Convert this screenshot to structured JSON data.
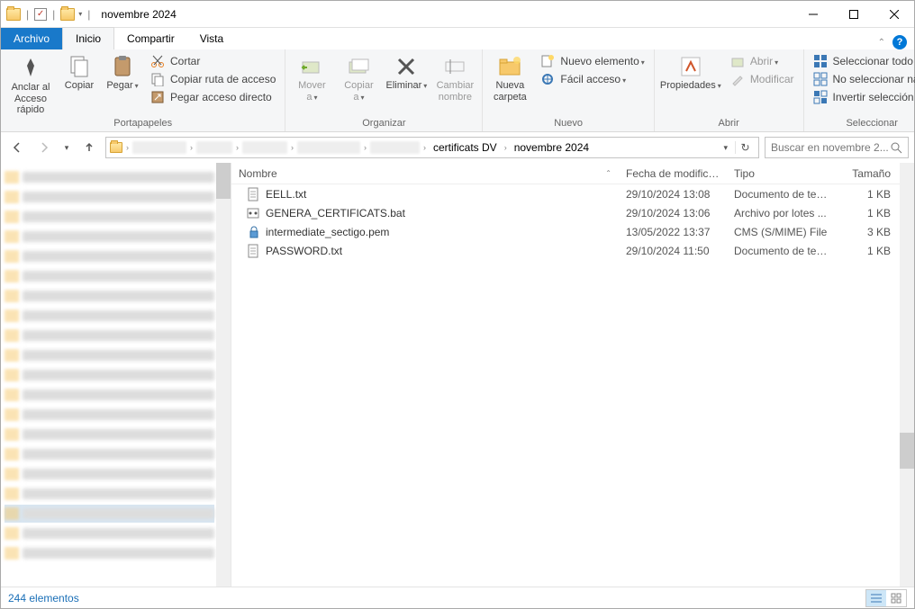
{
  "window": {
    "title": "novembre 2024"
  },
  "tabs": {
    "file": "Archivo",
    "home": "Inicio",
    "share": "Compartir",
    "view": "Vista"
  },
  "ribbon": {
    "clipboard": {
      "label": "Portapapeles",
      "pin": "Anclar al\nAcceso rápido",
      "copy": "Copiar",
      "paste": "Pegar",
      "cut": "Cortar",
      "copy_path": "Copiar ruta de acceso",
      "paste_shortcut": "Pegar acceso directo"
    },
    "organize": {
      "label": "Organizar",
      "move": "Mover\na",
      "copy_to": "Copiar\na",
      "delete": "Eliminar",
      "rename": "Cambiar\nnombre"
    },
    "new": {
      "label": "Nuevo",
      "folder": "Nueva\ncarpeta",
      "item": "Nuevo elemento",
      "easy": "Fácil acceso"
    },
    "open": {
      "label": "Abrir",
      "props": "Propiedades",
      "open": "Abrir",
      "edit": "Modificar"
    },
    "select": {
      "label": "Seleccionar",
      "all": "Seleccionar todo",
      "none": "No seleccionar nada",
      "invert": "Invertir selección"
    }
  },
  "breadcrumb": {
    "segments": [
      "certificats DV",
      "novembre 2024"
    ],
    "hidden_segments": 5
  },
  "search": {
    "placeholder": "Buscar en novembre 2..."
  },
  "columns": {
    "name": "Nombre",
    "date": "Fecha de modifica...",
    "type": "Tipo",
    "size": "Tamaño"
  },
  "files": [
    {
      "icon": "txt",
      "name": "EELL.txt",
      "date": "29/10/2024 13:08",
      "type": "Documento de tex...",
      "size": "1 KB"
    },
    {
      "icon": "bat",
      "name": "GENERA_CERTIFICATS.bat",
      "date": "29/10/2024 13:06",
      "type": "Archivo por lotes ...",
      "size": "1 KB"
    },
    {
      "icon": "pem",
      "name": "intermediate_sectigo.pem",
      "date": "13/05/2022 13:37",
      "type": "CMS (S/MIME) File",
      "size": "3 KB"
    },
    {
      "icon": "txt",
      "name": "PASSWORD.txt",
      "date": "29/10/2024 11:50",
      "type": "Documento de tex...",
      "size": "1 KB"
    }
  ],
  "status": {
    "count": "244 elementos"
  }
}
